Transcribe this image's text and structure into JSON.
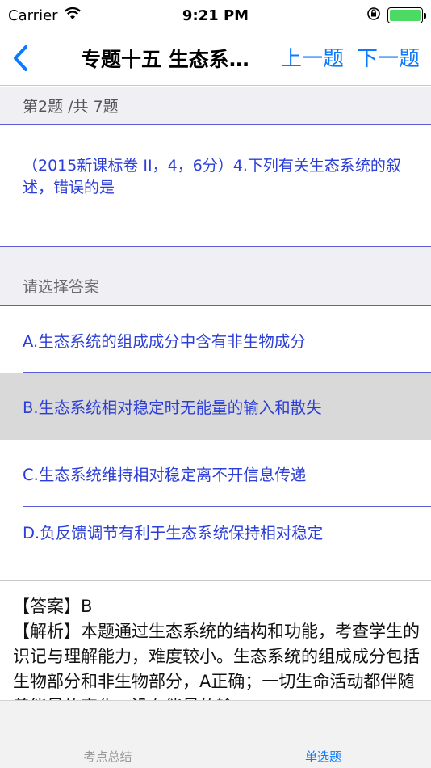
{
  "status": {
    "carrier": "Carrier",
    "time": "9:21 PM"
  },
  "nav": {
    "title": "专题十五 生态系统和环境保护",
    "prev_label": "上一题",
    "next_label": "下一题"
  },
  "counter": "第2题 /共 7题",
  "question": "（2015新课标卷 II，4，6分）4.下列有关生态系统的叙述，错误的是",
  "prompt": "请选择答案",
  "options": [
    {
      "label": "A.生态系统的组成成分中含有非生物成分"
    },
    {
      "label": "B.生态系统相对稳定时无能量的输入和散失"
    },
    {
      "label": "C.生态系统维持相对稳定离不开信息传递"
    },
    {
      "label": "D.负反馈调节有利于生态系统保持相对稳定"
    }
  ],
  "selected_option": 1,
  "answer": {
    "line1": "【答案】B",
    "line2": "【解析】本题通过生态系统的结构和功能，考查学生的识记与理解能力，难度较小。生态系统的组成成分包括生物部分和非生物部分，A正确；一切生命活动都伴随着能量的变化，没有能量的输"
  },
  "tabs": [
    {
      "label": "考点总结"
    },
    {
      "label": "单选题"
    }
  ],
  "colors": {
    "accent": "#0a7aff",
    "option_text": "#2c3ed8",
    "battery": "#4cd964"
  }
}
